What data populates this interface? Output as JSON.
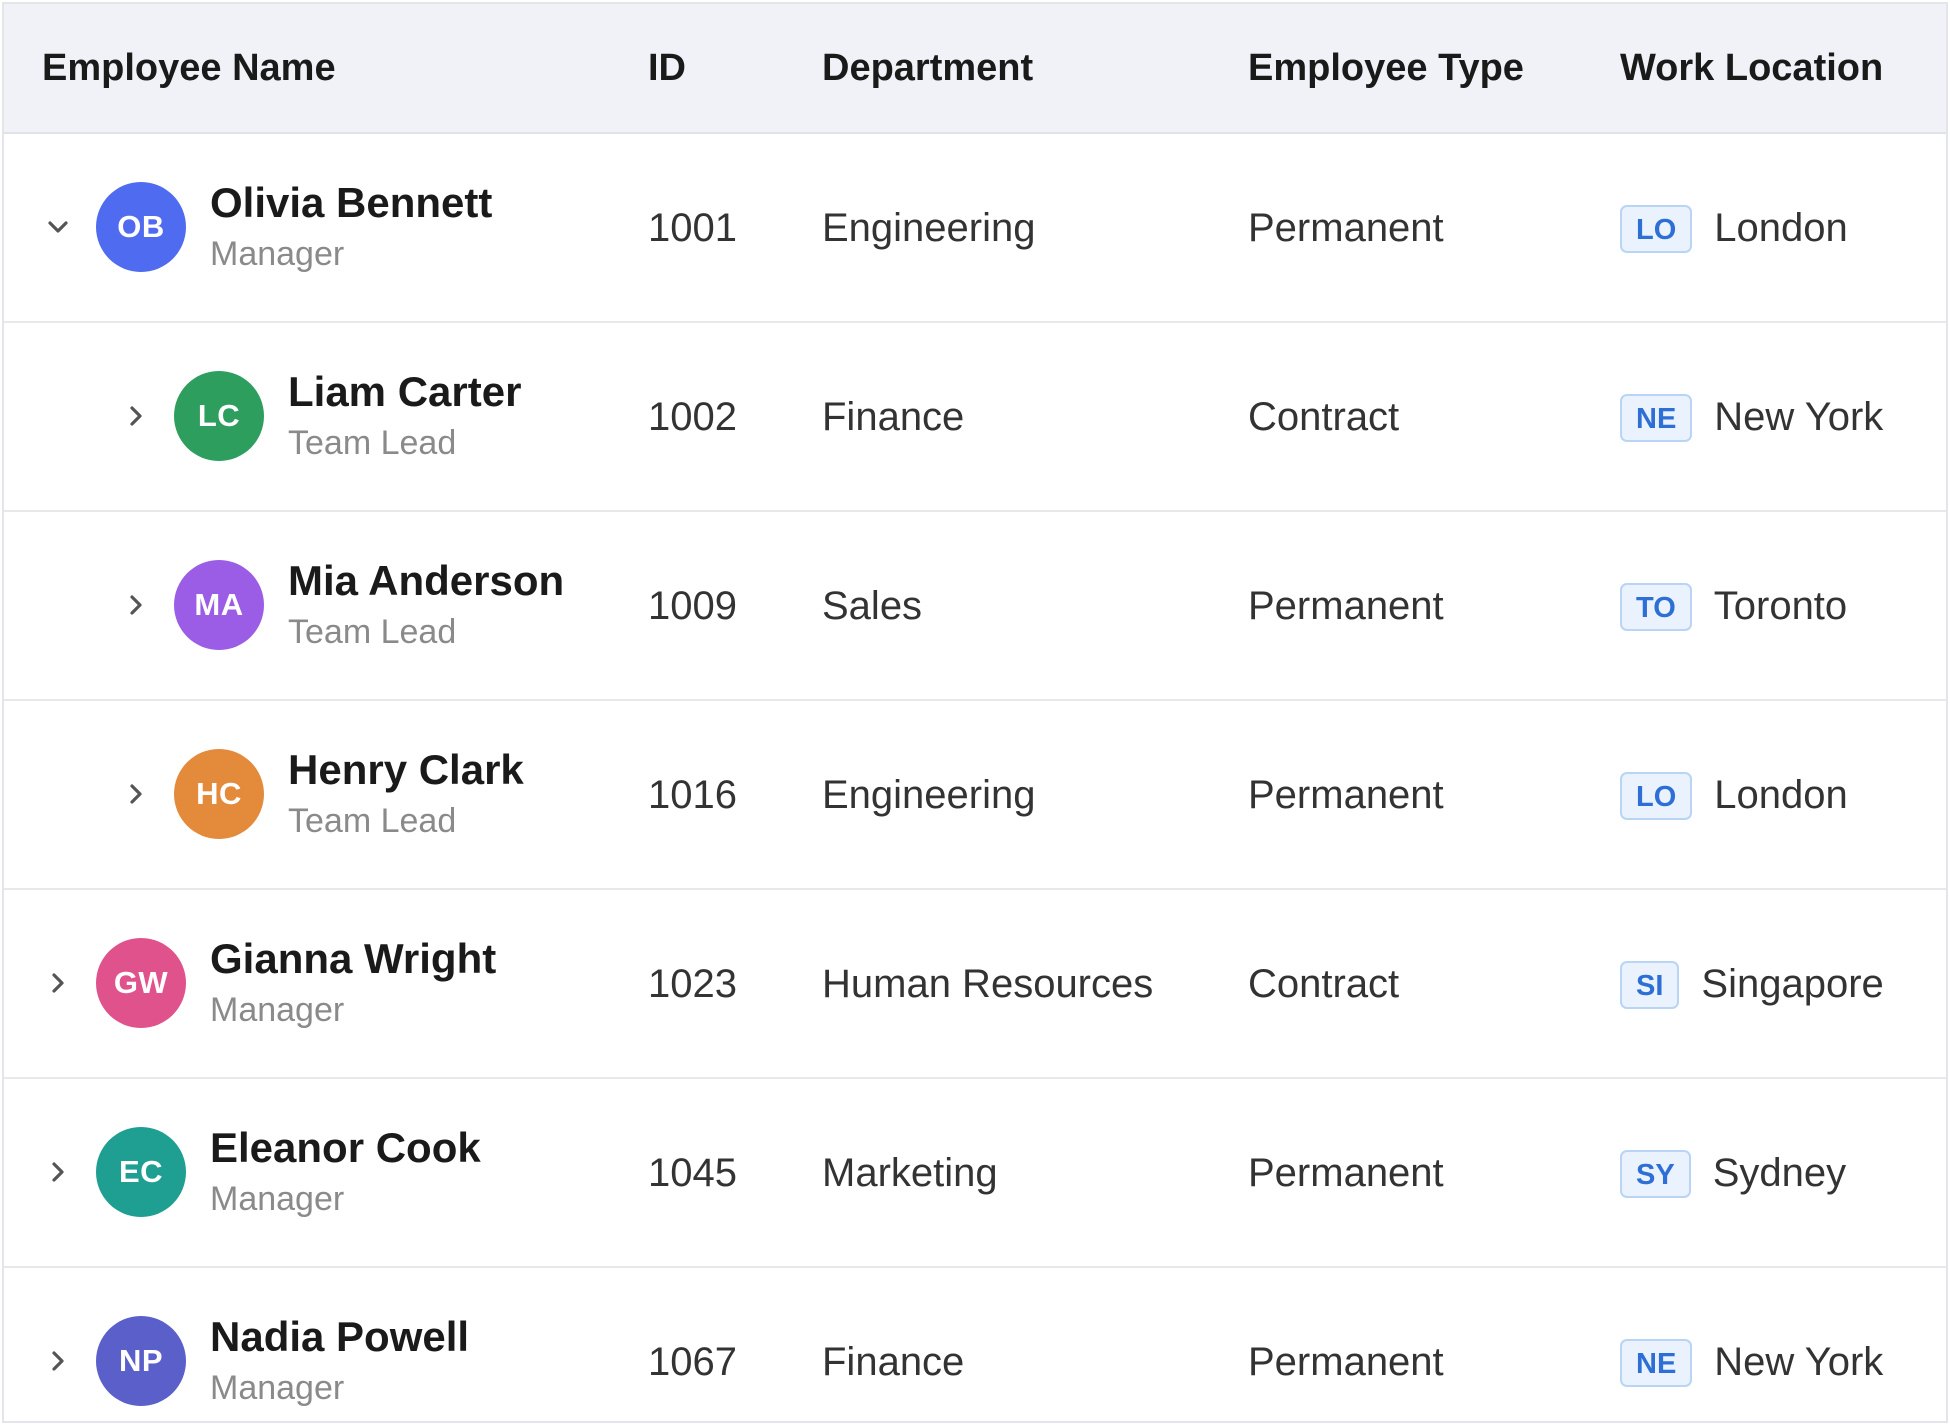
{
  "columns": {
    "name": "Employee Name",
    "id": "ID",
    "department": "Department",
    "type": "Employee Type",
    "location": "Work Location"
  },
  "rows": [
    {
      "initials": "OB",
      "name": "Olivia Bennett",
      "role": "Manager",
      "id": "1001",
      "department": "Engineering",
      "type": "Permanent",
      "loc_code": "LO",
      "location": "London",
      "level": 0,
      "expanded": true,
      "color": "#4f6bef"
    },
    {
      "initials": "LC",
      "name": "Liam Carter",
      "role": "Team Lead",
      "id": "1002",
      "department": "Finance",
      "type": "Contract",
      "loc_code": "NE",
      "location": "New York",
      "level": 1,
      "expanded": false,
      "color": "#2e9e5e"
    },
    {
      "initials": "MA",
      "name": "Mia Anderson",
      "role": "Team Lead",
      "id": "1009",
      "department": "Sales",
      "type": "Permanent",
      "loc_code": "TO",
      "location": "Toronto",
      "level": 1,
      "expanded": false,
      "color": "#9b5de5"
    },
    {
      "initials": "HC",
      "name": "Henry Clark",
      "role": "Team Lead",
      "id": "1016",
      "department": "Engineering",
      "type": "Permanent",
      "loc_code": "LO",
      "location": "London",
      "level": 1,
      "expanded": false,
      "color": "#e38a3b"
    },
    {
      "initials": "GW",
      "name": "Gianna Wright",
      "role": "Manager",
      "id": "1023",
      "department": "Human Resources",
      "type": "Contract",
      "loc_code": "SI",
      "location": "Singapore",
      "level": 0,
      "expanded": false,
      "color": "#e0528c"
    },
    {
      "initials": "EC",
      "name": "Eleanor Cook",
      "role": "Manager",
      "id": "1045",
      "department": "Marketing",
      "type": "Permanent",
      "loc_code": "SY",
      "location": "Sydney",
      "level": 0,
      "expanded": false,
      "color": "#1f9e92"
    },
    {
      "initials": "NP",
      "name": "Nadia Powell",
      "role": "Manager",
      "id": "1067",
      "department": "Finance",
      "type": "Permanent",
      "loc_code": "NE",
      "location": "New York",
      "level": 0,
      "expanded": false,
      "color": "#5a5fc9"
    }
  ]
}
